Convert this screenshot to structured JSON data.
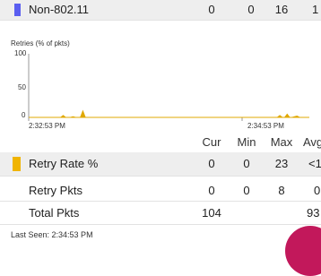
{
  "top_row": {
    "label": "Non-802.11",
    "color": "#5a5ef0",
    "cur": "0",
    "min": "0",
    "max": "16",
    "avg": "1"
  },
  "chart": {
    "ylabel": "Retries (% of pkts)",
    "y_ticks": [
      "100",
      "50",
      "0"
    ],
    "x_start": "2:32:53 PM",
    "x_end": "2:34:53 PM",
    "color": "#e0a800"
  },
  "chart_data": {
    "type": "area",
    "title": "",
    "ylabel": "Retries (% of pkts)",
    "ylim": [
      0,
      100
    ],
    "x_tick_labels": [
      "2:32:53 PM",
      "2:34:53 PM"
    ],
    "series": [
      {
        "values": [
          0,
          0,
          0,
          0,
          0,
          0,
          0,
          0,
          0,
          0,
          0,
          0,
          0,
          0,
          3,
          0,
          0,
          0,
          1,
          0,
          0,
          0,
          10,
          0,
          0,
          0,
          0,
          0,
          0,
          0,
          0,
          0,
          0,
          0,
          0,
          0,
          0,
          0,
          0,
          0,
          0,
          0,
          0,
          0,
          0,
          0,
          0,
          0,
          0,
          0,
          0,
          0,
          0,
          0,
          0,
          0,
          0,
          0,
          0,
          0,
          0,
          0,
          0,
          0,
          0,
          0,
          0,
          0,
          0,
          0,
          0,
          0,
          0,
          0,
          0,
          0,
          0,
          0,
          0,
          0,
          0,
          0,
          0,
          0,
          0,
          0,
          0,
          0,
          0,
          0,
          0,
          0,
          0,
          0,
          0,
          0,
          0,
          0,
          0,
          0,
          0,
          0,
          3,
          0,
          0,
          5,
          0,
          0,
          1,
          2,
          0,
          0,
          0,
          0,
          0
        ]
      }
    ]
  },
  "table": {
    "headers": [
      "Cur",
      "Min",
      "Max",
      "Avg"
    ],
    "rows": [
      {
        "label": "Retry Rate %",
        "cur": "0",
        "min": "0",
        "max": "23",
        "avg": "<1",
        "swatch": "#f0b400"
      },
      {
        "label": "Retry Pkts",
        "cur": "0",
        "min": "0",
        "max": "8",
        "avg": "0"
      },
      {
        "label": "Total Pkts",
        "cur": "104",
        "min": "",
        "max": "",
        "avg": "93"
      }
    ]
  },
  "footer": {
    "last_seen": "Last Seen: 2:34:53 PM"
  },
  "fab": {
    "color": "#c2185b"
  }
}
